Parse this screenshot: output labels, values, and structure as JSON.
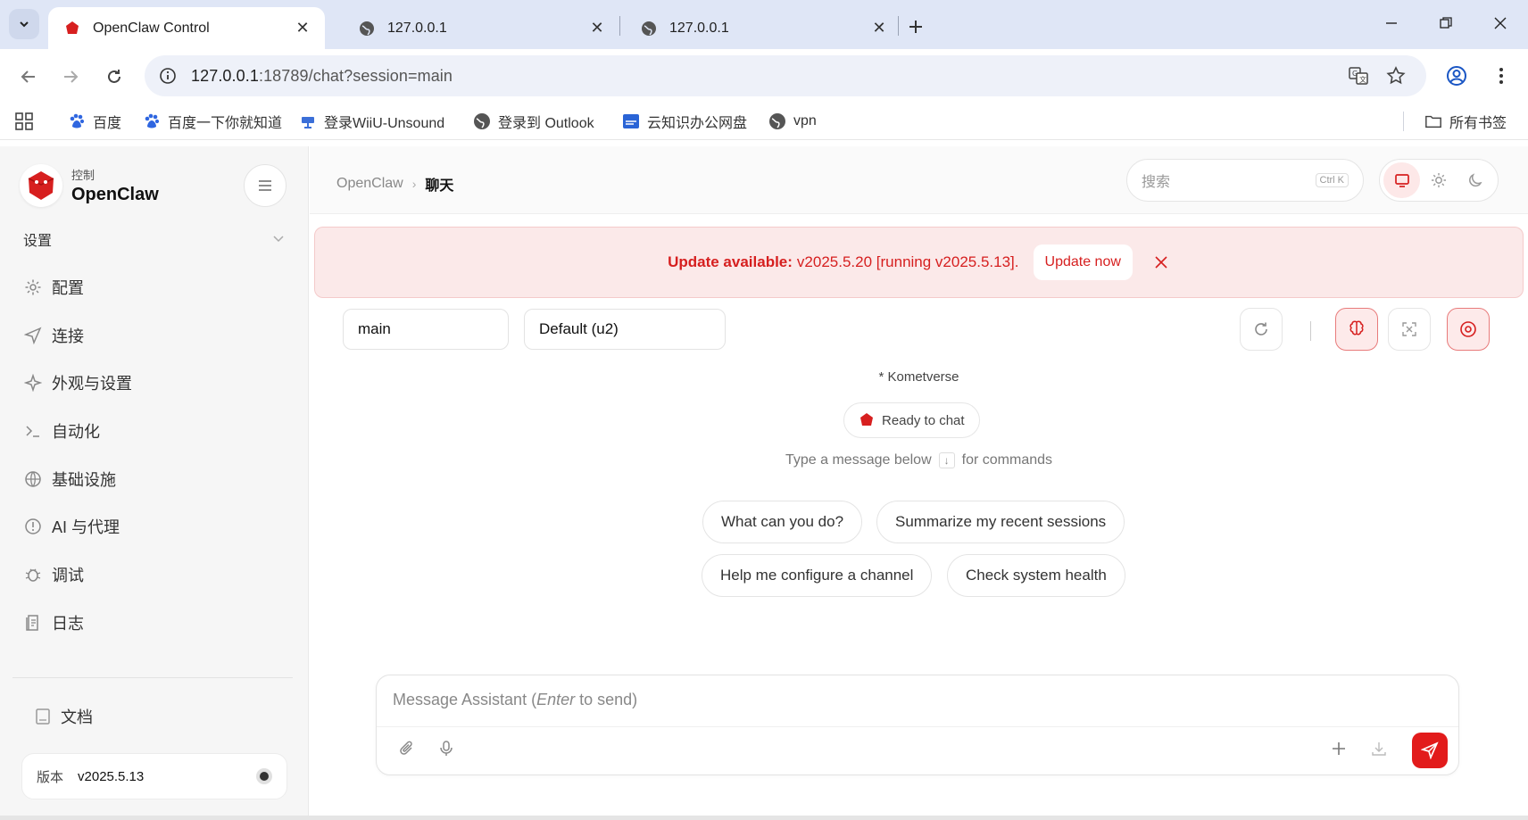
{
  "browser": {
    "tabs": [
      {
        "title": "OpenClaw Control",
        "active": true,
        "favicon": "openclaw-logo-icon"
      },
      {
        "title": "127.0.0.1",
        "active": false,
        "favicon": "globe-icon"
      },
      {
        "title": "127.0.0.1",
        "active": false,
        "favicon": "globe-icon"
      }
    ],
    "url": {
      "host": "127.0.0.1",
      "rest": ":18789/chat?session=main"
    },
    "bookmarks": [
      {
        "label": "百度",
        "icon": "baidu-paw-icon"
      },
      {
        "label": "百度一下你就知道",
        "icon": "baidu-paw-icon"
      },
      {
        "label": "登录WiiU-Unsound",
        "icon": "wiiu-icon"
      },
      {
        "label": "登录到 Outlook",
        "icon": "globe-icon"
      },
      {
        "label": "云知识办公网盘",
        "icon": "cloud-drive-icon"
      },
      {
        "label": "vpn",
        "icon": "globe-icon"
      }
    ],
    "all_bookmarks_label": "所有书签"
  },
  "sidebar": {
    "brand_sub": "控制",
    "brand_name": "OpenClaw",
    "section_label": "设置",
    "items": [
      {
        "label": "配置",
        "icon": "gear-icon"
      },
      {
        "label": "连接",
        "icon": "send-icon"
      },
      {
        "label": "外观与设置",
        "icon": "sparkle-icon"
      },
      {
        "label": "自动化",
        "icon": "terminal-icon"
      },
      {
        "label": "基础设施",
        "icon": "globe-icon"
      },
      {
        "label": "AI 与代理",
        "icon": "ai-icon"
      },
      {
        "label": "调试",
        "icon": "bug-icon"
      },
      {
        "label": "日志",
        "icon": "log-icon"
      }
    ],
    "docs_label": "文档",
    "version_label": "版本",
    "version_value": "v2025.5.13"
  },
  "header": {
    "breadcrumb_root": "OpenClaw",
    "breadcrumb_current": "聊天",
    "search_placeholder": "搜索",
    "search_shortcut": "Ctrl K"
  },
  "banner": {
    "strong": "Update available:",
    "text": "v2025.5.20 [running v2025.5.13].",
    "button": "Update now"
  },
  "chat": {
    "session_select": "main",
    "model_select": "Default (u2)",
    "agent_name": "* Kometverse",
    "status": "Ready to chat",
    "hint_before": "Type a message below",
    "hint_key": "↓",
    "hint_after": "for commands",
    "suggestions": [
      "What can you do?",
      "Summarize my recent sessions",
      "Help me configure a channel",
      "Check system health"
    ],
    "input_placeholder_start": "Message Assistant (",
    "input_placeholder_key": "Enter",
    "input_placeholder_end": " to send)"
  },
  "colors": {
    "accent": "#e21b1b",
    "banner_bg": "#fbe9e9",
    "sidebar_bg": "#f6f6f6"
  }
}
